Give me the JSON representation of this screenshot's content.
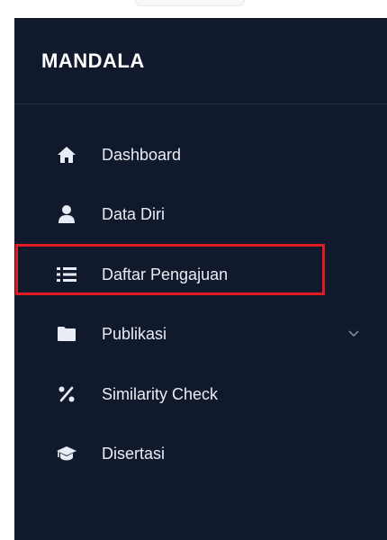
{
  "brand": {
    "title": "MANDALA"
  },
  "menu": {
    "items": [
      {
        "label": "Dashboard",
        "icon": "home-icon"
      },
      {
        "label": "Data Diri",
        "icon": "user-icon"
      },
      {
        "label": "Daftar Pengajuan",
        "icon": "list-icon"
      },
      {
        "label": "Publikasi",
        "icon": "folder-icon",
        "has_submenu": true
      },
      {
        "label": "Similarity Check",
        "icon": "percent-icon",
        "highlighted": true
      },
      {
        "label": "Disertasi",
        "icon": "graduation-cap-icon"
      }
    ]
  },
  "colors": {
    "sidebar_bg": "#111a2c",
    "text": "#e8edf5",
    "highlight": "#e31b23"
  }
}
